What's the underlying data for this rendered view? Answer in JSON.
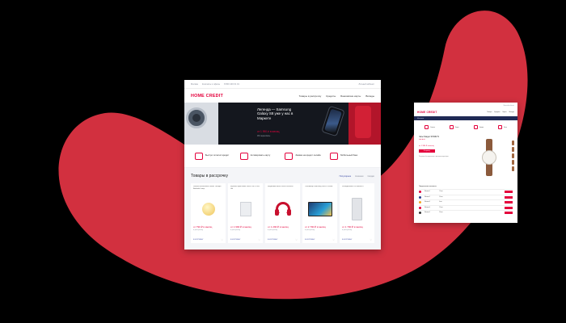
{
  "colors": {
    "background": "#000000",
    "swoosh": "#d2303f",
    "brand": "#e4003c",
    "navy": "#1f2a55"
  },
  "main_page": {
    "topbar": {
      "links": [
        "Москва",
        "Контакты и офисы",
        "8 800 100 01 01"
      ],
      "right": "Личный кабинет"
    },
    "header": {
      "logo": "HOME CREDIT",
      "nav": [
        "Товары в рассрочку",
        "Кредиты",
        "Банковские карты",
        "Вклады"
      ]
    },
    "hero": {
      "title": "Легенда — Samsung Galaxy S8 уже у нас в Маркете",
      "price": "от 1 990 ₽ в месяц",
      "note": "0% переплаты"
    },
    "features": [
      {
        "label": "Быстро оплатил кредит",
        "icon": "credit-card-icon"
      },
      {
        "label": "Активировать карту",
        "icon": "card-check-icon"
      },
      {
        "label": "Заявка на кредит онлайн",
        "icon": "document-icon"
      },
      {
        "label": "Мобильный банк",
        "icon": "smartphone-icon"
      }
    ],
    "products": {
      "title": "Товары в рассрочку",
      "tabs": [
        "Популярное",
        "Новинки",
        "Скидки"
      ],
      "active_tab": 0,
      "items": [
        {
          "desc": "Умный светильник Xiaomi Yeelight Bedside Lamp",
          "price": "от 790 ₽ в месяц",
          "sub": "в рассрочку",
          "buy": "В КОРЗИНУ",
          "image": "lamp"
        },
        {
          "desc": "Игровая приставка Xbox One S 500 Gb",
          "price": "от 1 990 ₽ в месяц",
          "sub": "в рассрочку",
          "buy": "В КОРЗИНУ",
          "image": "console"
        },
        {
          "desc": "Наушники Beats Solo3 Wireless",
          "price": "от 1 290 ₽ в месяц",
          "sub": "в рассрочку",
          "buy": "В КОРЗИНУ",
          "image": "headphones"
        },
        {
          "desc": "Телевизор Samsung UE49 Curved",
          "price": "от 2 790 ₽ в месяц",
          "sub": "в рассрочку",
          "buy": "В КОРЗИНУ",
          "image": "tv"
        },
        {
          "desc": "Холодильник LG GA-B419",
          "price": "от 1 790 ₽ в месяц",
          "sub": "в рассрочку",
          "buy": "В КОРЗИНУ",
          "image": "fridge"
        }
      ]
    }
  },
  "side_page": {
    "top": "Личный кабинет",
    "header": {
      "logo": "HOME CREDIT",
      "nav": [
        "Товары",
        "Кредиты",
        "Карты",
        "Вклады"
      ]
    },
    "bar": "Магазины",
    "features": [
      "Оплата",
      "Карта",
      "Заявка",
      "Банк"
    ],
    "product": {
      "name": "Часы Skagen SKW6271",
      "rating": "★★★★☆",
      "price": "от 1 990 ₽ в месяц",
      "button": "В корзину",
      "info": "Рассрочка без переплаты в магазинах-партнёрах"
    },
    "table": {
      "title": "Предложения магазинов",
      "rows": [
        {
          "shop": "Магазин 1",
          "term": "12 мес",
          "color": "#e4003c"
        },
        {
          "shop": "Магазин 2",
          "term": "10 мес",
          "color": "#2c3e8f"
        },
        {
          "shop": "Магазин 3",
          "term": "6 мес",
          "color": "#f5a623"
        },
        {
          "shop": "Магазин 4",
          "term": "12 мес",
          "color": "#e4003c"
        },
        {
          "shop": "Магазин 5",
          "term": "24 мес",
          "color": "#333333"
        }
      ]
    }
  }
}
